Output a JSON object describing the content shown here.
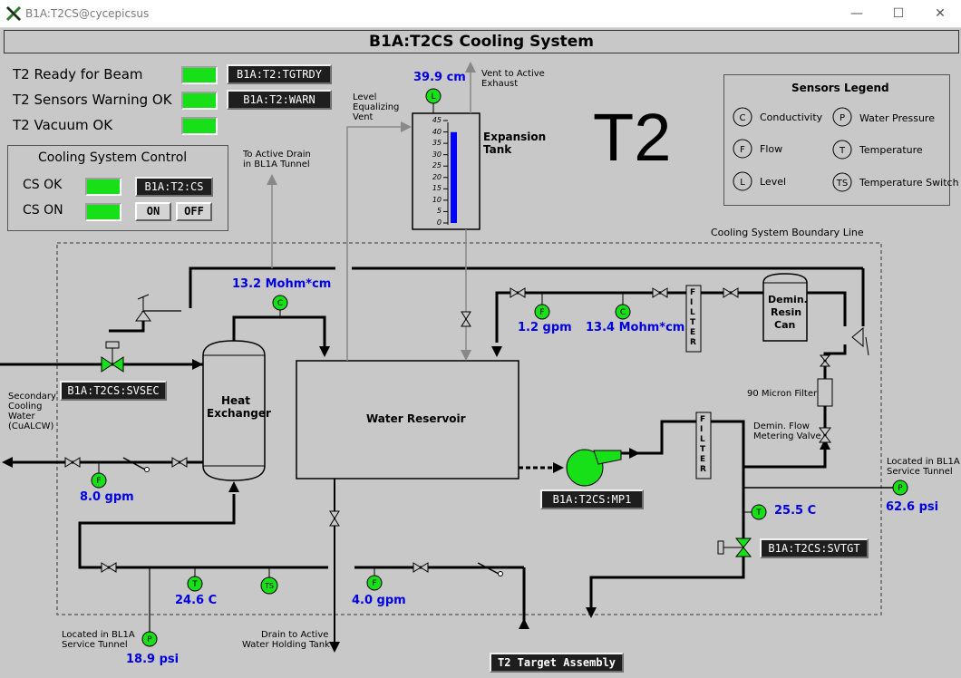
{
  "window": {
    "title": "B1A:T2CS@cycepicsus",
    "minimize": "—",
    "maximize": "☐",
    "close": "✕"
  },
  "header": {
    "title": "B1A:T2CS  Cooling System"
  },
  "status": {
    "ready_label": "T2 Ready for Beam",
    "ready_pv": "B1A:T2:TGTRDY",
    "warn_label": "T2 Sensors Warning OK",
    "warn_pv": "B1A:T2:WARN",
    "vacuum_label": "T2 Vacuum OK"
  },
  "control": {
    "title": "Cooling System Control",
    "cs_ok": "CS OK",
    "cs_ok_pv": "B1A:T2:CS",
    "cs_on": "CS ON",
    "on_label": "ON",
    "off_label": "OFF"
  },
  "big_label": "T2",
  "legend": {
    "title": "Sensors Legend",
    "items": [
      {
        "sym": "C",
        "name": "Conductivity"
      },
      {
        "sym": "P",
        "name": "Water Pressure"
      },
      {
        "sym": "F",
        "name": "Flow"
      },
      {
        "sym": "T",
        "name": "Temperature"
      },
      {
        "sym": "L",
        "name": "Level"
      },
      {
        "sym": "TS",
        "name": "Temperature Switch"
      }
    ]
  },
  "labels": {
    "boundary": "Cooling System Boundary Line",
    "vent_exhaust_1": "Vent to Active",
    "vent_exhaust_2": "Exhaust",
    "level_vent_1": "Level",
    "level_vent_2": "Equalizing",
    "level_vent_3": "Vent",
    "active_drain_1": "To Active Drain",
    "active_drain_2": "in BL1A Tunnel",
    "expansion_1": "Expansion",
    "expansion_2": "Tank",
    "heat_1": "Heat",
    "heat_2": "Exchanger",
    "reservoir": "Water Reservoir",
    "demin_1": "Demin.",
    "demin_2": "Resin",
    "demin_3": "Can",
    "micron": "90 Micron Filter",
    "metering_1": "Demin. Flow",
    "metering_2": "Metering Valve",
    "secondary_1": "Secondary",
    "secondary_2": "Cooling",
    "secondary_3": "Water",
    "secondary_4": "(CuALCW)",
    "loc_bl1a_1": "Located in BL1A",
    "loc_bl1a_2": "Service Tunnel",
    "loc_bl1a_r1": "Located in BL1A",
    "loc_bl1a_r2": "Service Tunnel",
    "drain_hold_1": "Drain to Active",
    "drain_hold_2": "Water Holding Tank",
    "filter": "FILTER",
    "tank_ticks": [
      "45",
      "40",
      "35",
      "30",
      "25",
      "20",
      "15",
      "10",
      "5",
      "0"
    ]
  },
  "readings": {
    "level": "39.9 cm",
    "cond_hx": "13.2 Mohm*cm",
    "flow_demin": "1.2 gpm",
    "cond_demin": "13.4 Mohm*cm",
    "flow_secondary": "8.0 gpm",
    "temp_supply": "25.5 C",
    "pressure_supply": "62.6 psi",
    "temp_return": "24.6 C",
    "flow_return": "4.0 gpm",
    "pressure_return": "18.9 psi"
  },
  "level_fraction": 0.887,
  "pvs": {
    "svsec": "B1A:T2CS:SVSEC",
    "mp1": "B1A:T2CS:MP1",
    "svtgt": "B1A:T2CS:SVTGT",
    "target": "T2 Target Assembly"
  },
  "colors": {
    "led_on": "#18e018",
    "reading": "#0000e0",
    "bg": "#c8c8c8"
  }
}
